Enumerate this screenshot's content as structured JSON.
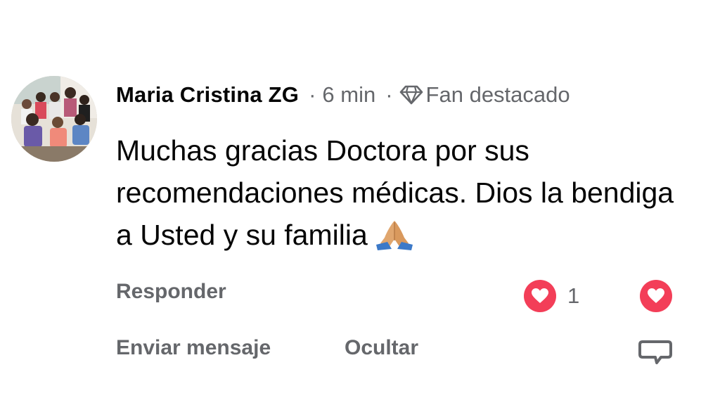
{
  "comment": {
    "author": "Maria Cristina ZG",
    "time": "6 min",
    "separator": "·",
    "badge_label": "Fan destacado",
    "badge_icon": "diamond-icon",
    "text": "Muchas gracias Doctora por sus recomendaciones médicas. Dios la bendiga a Usted y su familia",
    "emoji": "folded-hands-emoji"
  },
  "actions": {
    "reply": "Responder",
    "send_message": "Enviar mensaje",
    "hide": "Ocultar"
  },
  "reactions": {
    "icon": "heart-icon",
    "count": "1",
    "color": "#f33e58"
  },
  "colors": {
    "text_primary": "#050505",
    "text_secondary": "#65676b",
    "background": "#ffffff"
  }
}
